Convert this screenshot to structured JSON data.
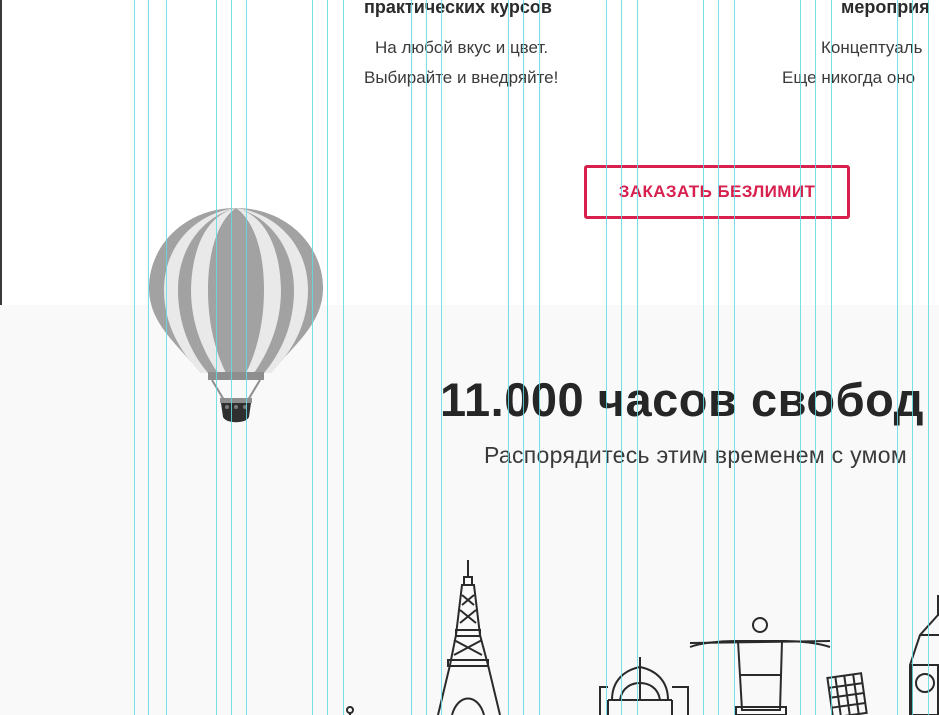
{
  "courses": {
    "title": "практических курсов",
    "line1": "На любой вкус и цвет.",
    "line2": "Выбирайте и внедряйте!"
  },
  "events": {
    "title": "мероприя",
    "line1": "Концептуаль",
    "line2": "Еще никогда оно"
  },
  "cta": {
    "label": "ЗАКАЗАТЬ БЕЗЛИМИТ",
    "color": "#d8204e"
  },
  "hero": {
    "heading": "11.000 часов свобод",
    "subheading": "Распорядитесь этим временем с умом"
  },
  "illustrations": {
    "balloon": "hot-air-balloon-icon",
    "landmarks": [
      "eiffel-tower-icon",
      "taj-mahal-icon",
      "christ-the-redeemer-icon",
      "leaning-tower-icon",
      "big-ben-icon"
    ]
  },
  "colors": {
    "accent": "#d8204e",
    "guide": "#62dbe3",
    "section_bg": "#f9f9f9"
  }
}
